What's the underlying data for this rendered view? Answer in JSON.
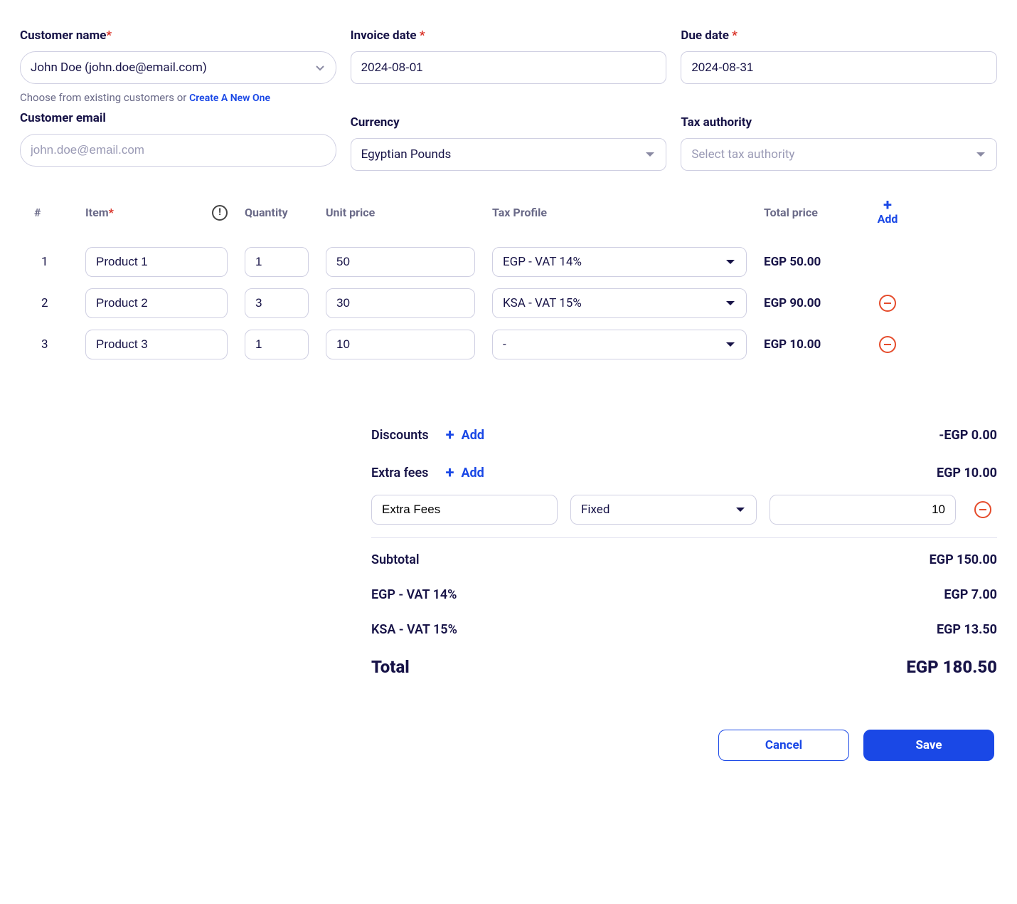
{
  "form": {
    "customer_name": {
      "label": "Customer name",
      "value": "John Doe (john.doe@email.com)",
      "hint_prefix": "Choose from existing customers or ",
      "hint_link": "Create A New One"
    },
    "invoice_date": {
      "label": "Invoice date ",
      "value": "2024-08-01"
    },
    "due_date": {
      "label": "Due date ",
      "value": "2024-08-31"
    },
    "customer_email": {
      "label": "Customer email",
      "placeholder": "john.doe@email.com"
    },
    "currency": {
      "label": "Currency",
      "value": "Egyptian Pounds"
    },
    "tax_authority": {
      "label": "Tax authority",
      "placeholder": "Select tax authority"
    }
  },
  "items": {
    "headers": {
      "num": "#",
      "item": "Item",
      "quantity": "Quantity",
      "unit_price": "Unit price",
      "tax_profile": "Tax Profile",
      "total_price": "Total price",
      "add": "Add"
    },
    "rows": [
      {
        "num": "1",
        "item": "Product 1",
        "qty": "1",
        "unit_price": "50",
        "tax": "EGP - VAT 14%",
        "total": "EGP 50.00",
        "removable": false
      },
      {
        "num": "2",
        "item": "Product 2",
        "qty": "3",
        "unit_price": "30",
        "tax": "KSA - VAT 15%",
        "total": "EGP 90.00",
        "removable": true
      },
      {
        "num": "3",
        "item": "Product 3",
        "qty": "1",
        "unit_price": "10",
        "tax": "-",
        "total": "EGP 10.00",
        "removable": true
      }
    ]
  },
  "summary": {
    "discounts": {
      "label": "Discounts",
      "add": "Add",
      "value": "-EGP 0.00"
    },
    "extra_fees": {
      "label": "Extra fees",
      "add": "Add",
      "value": "EGP 10.00"
    },
    "extra_fee_line": {
      "name": "Extra Fees",
      "type": "Fixed",
      "amount": "10"
    },
    "subtotal": {
      "label": "Subtotal",
      "value": "EGP 150.00"
    },
    "tax_lines": [
      {
        "label": "EGP - VAT 14%",
        "value": "EGP 7.00"
      },
      {
        "label": "KSA - VAT 15%",
        "value": "EGP 13.50"
      }
    ],
    "total": {
      "label": "Total",
      "value": "EGP 180.50"
    }
  },
  "actions": {
    "cancel": "Cancel",
    "save": "Save"
  }
}
